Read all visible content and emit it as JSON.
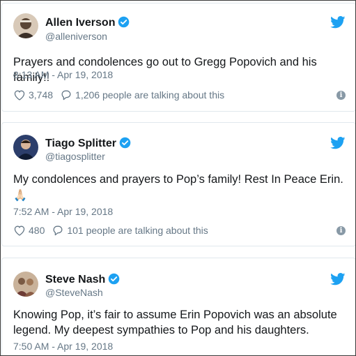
{
  "tweets": [
    {
      "name": "Allen Iverson",
      "handle": "@alleniverson",
      "text": "Prayers and condolences go out to Gregg Popovich and his family!!",
      "timestamp": "8:13 AM - Apr 19, 2018",
      "likes": "3,748",
      "replies": "1,206 people are talking about this",
      "avatar_color": "#5a4636"
    },
    {
      "name": "Tiago Splitter",
      "handle": "@tiagosplitter",
      "text": "My condolences and prayers to Pop’s family! Rest In Peace Erin.",
      "emoji": "🙏🏻",
      "timestamp": "7:52 AM - Apr 19, 2018",
      "likes": "480",
      "replies": "101 people are talking about this",
      "avatar_color": "#1b2a4a"
    },
    {
      "name": "Steve Nash",
      "handle": "@SteveNash",
      "text": "Knowing Pop, it’s fair to assume Erin Popovich was an absolute legend. My deepest sympathies to Pop and his daughters.",
      "timestamp": "7:50 AM - Apr 19, 2018",
      "avatar_color": "#8a6a52"
    }
  ],
  "icons": {
    "verified": "verified-badge-icon",
    "twitter": "twitter-bird-icon",
    "like": "heart-icon",
    "reply": "speech-bubble-icon",
    "info": "info-icon"
  },
  "colors": {
    "brand_blue": "#1da1f2",
    "secondary_text": "#657786",
    "primary_text": "#14171a"
  }
}
